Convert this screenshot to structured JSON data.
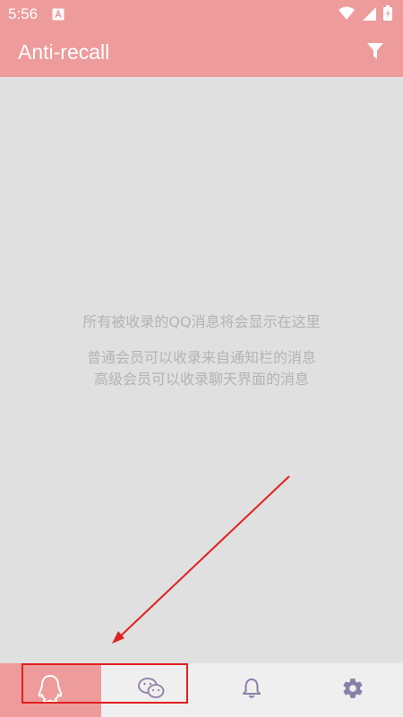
{
  "status_bar": {
    "time": "5:56",
    "icons": [
      "notification-app-icon",
      "wifi-icon",
      "signal-icon",
      "battery-icon"
    ]
  },
  "app_bar": {
    "title": "Anti-recall",
    "filter_icon": "filter-icon"
  },
  "empty_state": {
    "line1": "所有被收录的QQ消息将会显示在这里",
    "line2": "普通会员可以收录来自通知栏的消息",
    "line3": "高级会员可以收录聊天界面的消息"
  },
  "bottom_nav": {
    "items": [
      {
        "icon": "qq-icon",
        "active": true
      },
      {
        "icon": "wechat-icon",
        "active": false
      },
      {
        "icon": "bell-icon",
        "active": false
      },
      {
        "icon": "gear-icon",
        "active": false
      }
    ]
  },
  "colors": {
    "accent": "#ee9b9b",
    "icon_inactive": "#8a7fa8",
    "annotation": "#e02020"
  }
}
